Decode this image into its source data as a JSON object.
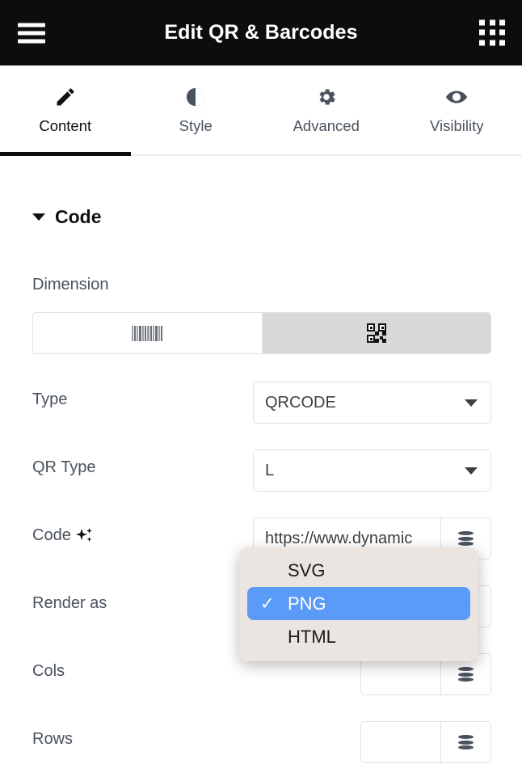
{
  "header": {
    "title": "Edit QR & Barcodes",
    "menu_icon": "hamburger-menu-icon",
    "apps_icon": "grid-apps-icon"
  },
  "tabs": [
    {
      "label": "Content",
      "icon": "pencil-icon",
      "active": true
    },
    {
      "label": "Style",
      "icon": "contrast-icon",
      "active": false
    },
    {
      "label": "Advanced",
      "icon": "gear-icon",
      "active": false
    },
    {
      "label": "Visibility",
      "icon": "eye-icon",
      "active": false
    }
  ],
  "section": {
    "title": "Code",
    "expanded": true
  },
  "fields": {
    "dimension": {
      "label": "Dimension",
      "options": [
        {
          "icon": "barcode-icon",
          "selected": false
        },
        {
          "icon": "qrcode-icon",
          "selected": true
        }
      ]
    },
    "type": {
      "label": "Type",
      "value": "QRCODE"
    },
    "qr_type": {
      "label": "QR Type",
      "value": "L"
    },
    "code": {
      "label": "Code",
      "icon": "sparkles-icon",
      "value": "https://www.dynamic",
      "placeholder": "",
      "dynamic_icon": "database-icon"
    },
    "render_as": {
      "label": "Render as",
      "value": "PNG"
    },
    "cols": {
      "label": "Cols",
      "value": "",
      "placeholder": "",
      "dynamic_icon": "database-icon"
    },
    "rows": {
      "label": "Rows",
      "value": "",
      "placeholder": "",
      "dynamic_icon": "database-icon"
    }
  },
  "dropdown": {
    "open": true,
    "items": [
      {
        "label": "SVG",
        "selected": false
      },
      {
        "label": "PNG",
        "selected": true
      },
      {
        "label": "HTML",
        "selected": false
      }
    ],
    "check_glyph": "✓"
  },
  "colors": {
    "appbar_bg": "#0d0d0d",
    "accent_selected": "#5b9bf8",
    "popup_bg": "#eae5e0",
    "label_text": "#4a525e",
    "border": "#dfe1e3",
    "segment_selected_bg": "#d6d8da"
  }
}
